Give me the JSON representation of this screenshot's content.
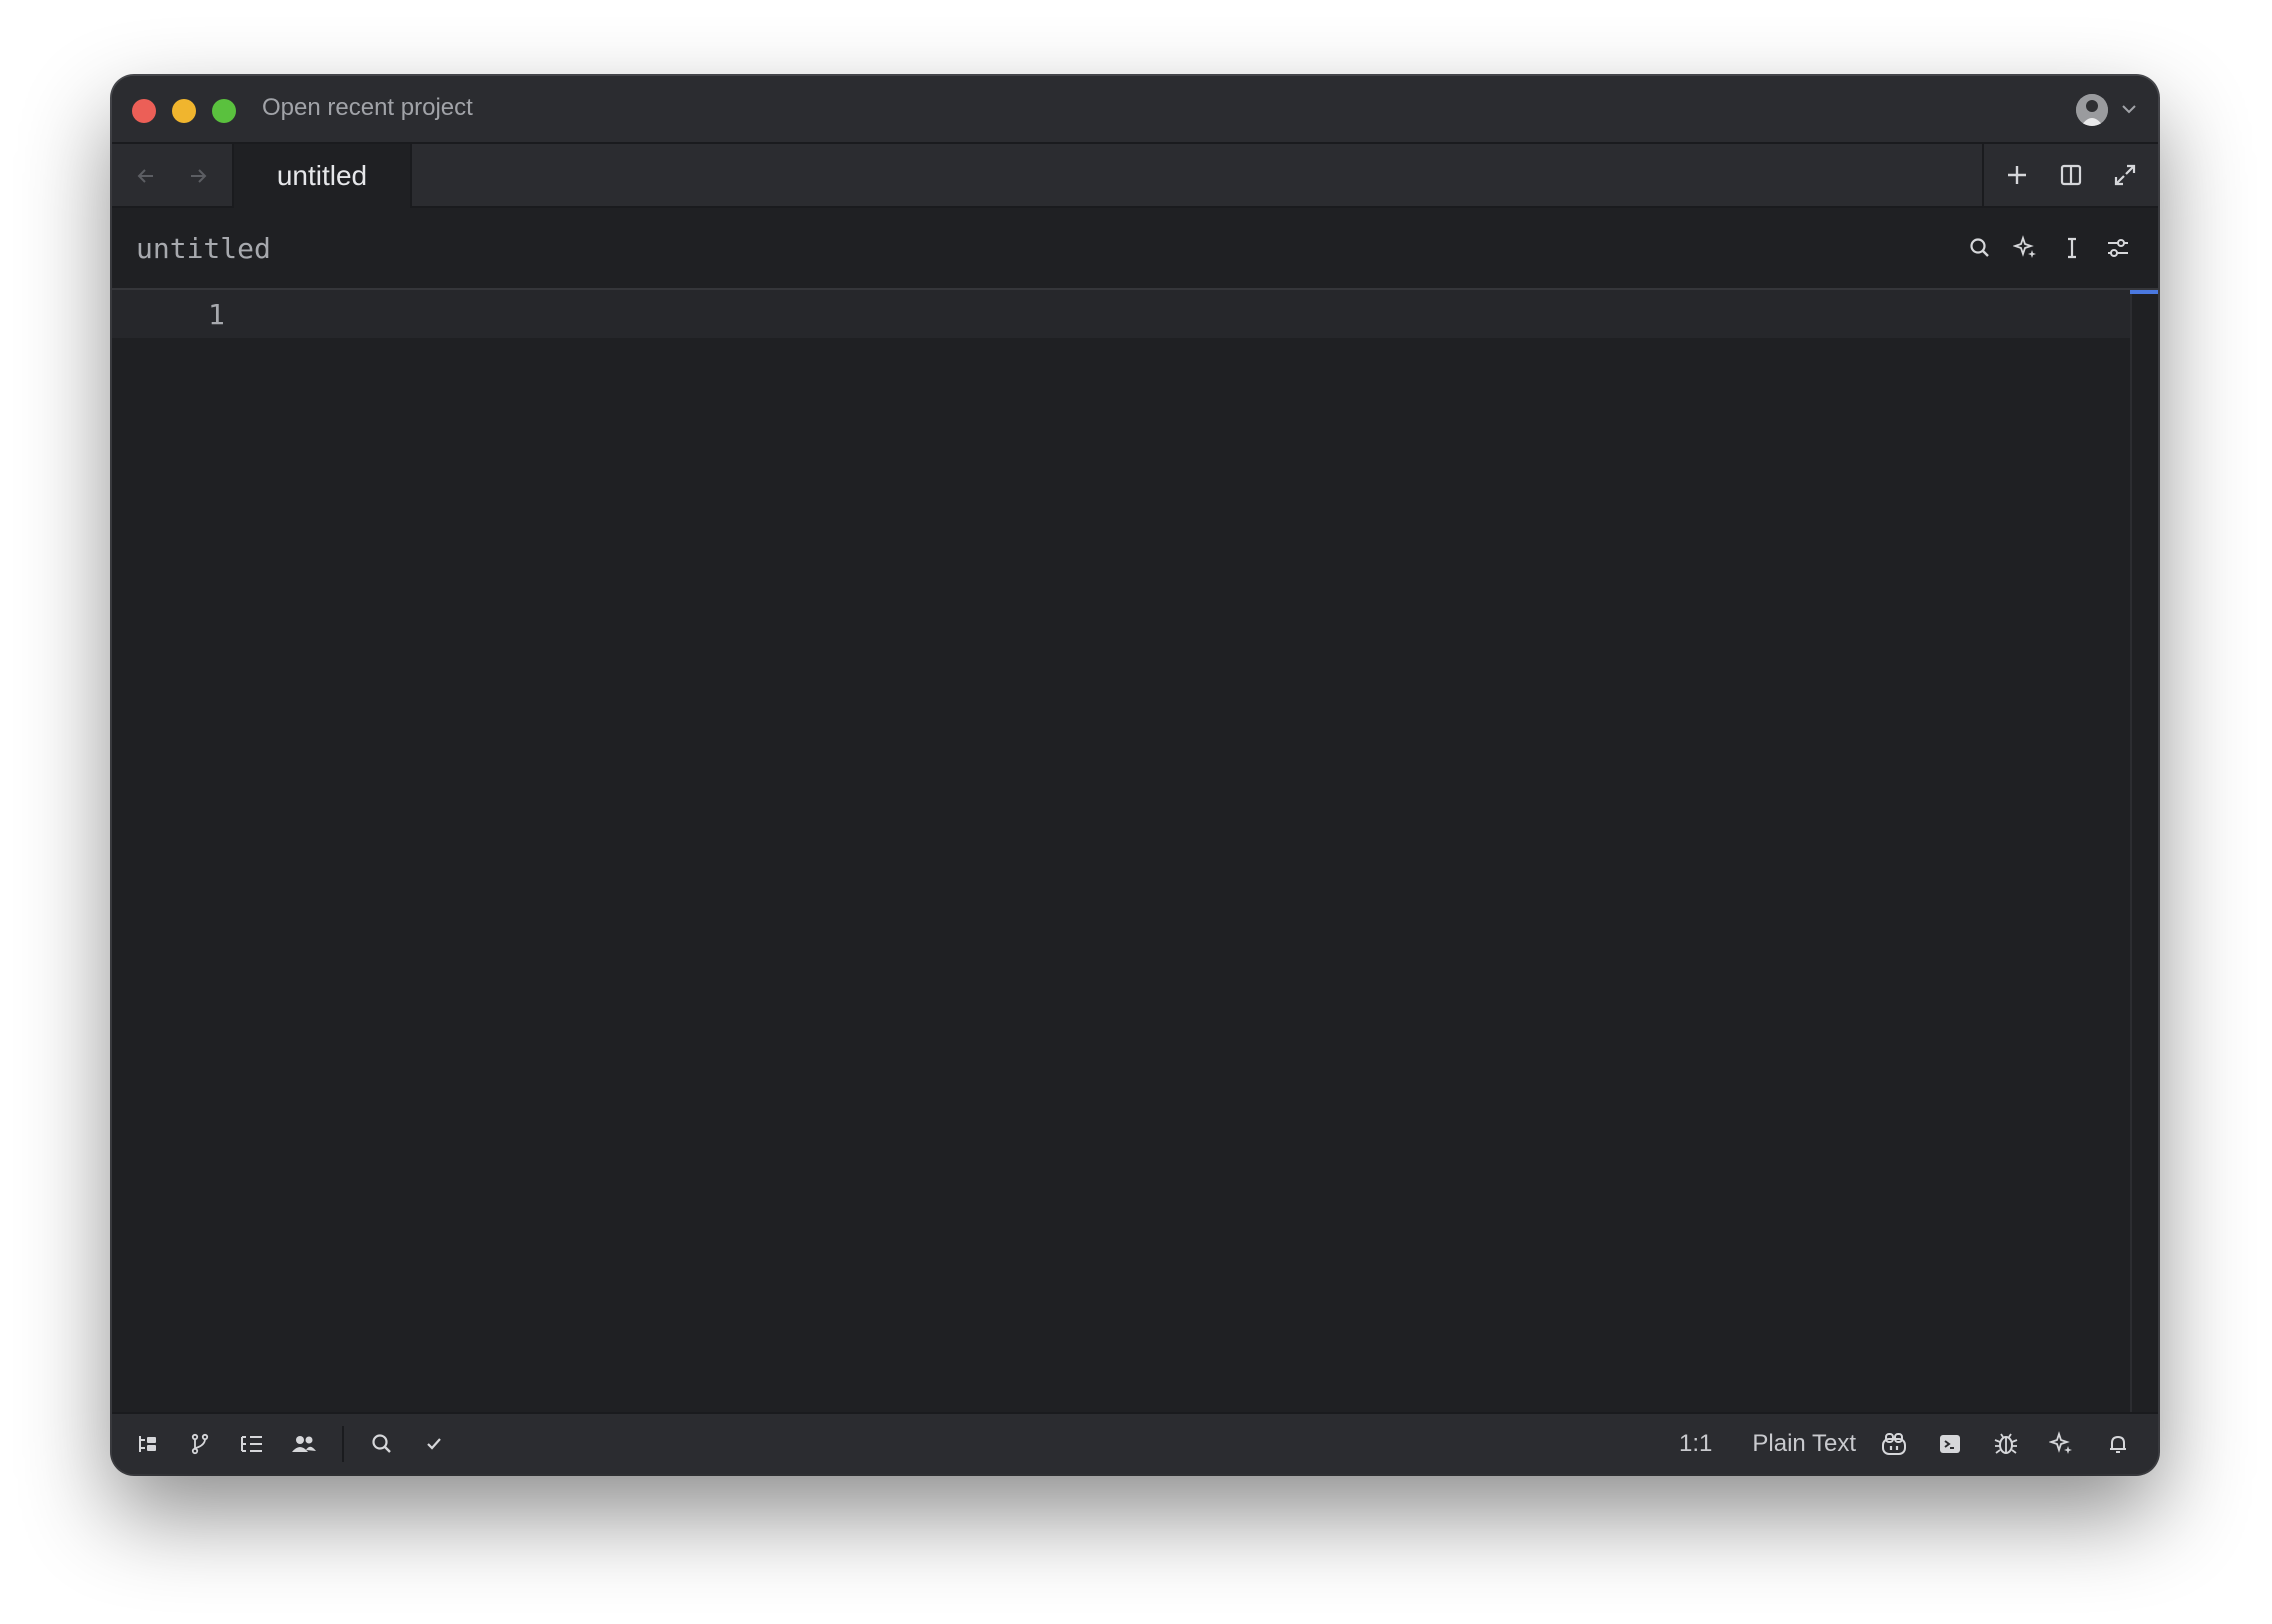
{
  "window": {
    "title": "Open recent project"
  },
  "tabs": [
    {
      "label": "untitled",
      "active": true
    }
  ],
  "breadcrumb": {
    "title": "untitled"
  },
  "editor": {
    "line_numbers": [
      "1"
    ],
    "content": ""
  },
  "statusbar": {
    "cursor_position": "1:1",
    "language": "Plain Text"
  },
  "icons": {
    "titlebar": [
      "avatar",
      "chevron-down-icon"
    ],
    "tabbar_left": [
      "arrow-left-icon",
      "arrow-right-icon"
    ],
    "tabbar_right": [
      "plus-icon",
      "split-pane-icon",
      "expand-icon"
    ],
    "breadcrumb": [
      "search-icon",
      "sparkle-icon",
      "text-cursor-icon",
      "settings-sliders-icon"
    ],
    "statusbar_left": [
      "project-panel-icon",
      "git-branch-icon",
      "outline-icon",
      "collab-icon",
      "search-icon",
      "check-icon"
    ],
    "statusbar_right": [
      "copilot-icon",
      "terminal-icon",
      "debug-icon",
      "assistant-icon",
      "bell-icon"
    ]
  },
  "colors": {
    "traffic_red": "#ec5f57",
    "traffic_yellow": "#f0b52e",
    "traffic_green": "#5ac13e",
    "editor_bg": "#1f2023",
    "chrome_bg": "#2b2c30",
    "accent_blue": "#4a78e0"
  }
}
